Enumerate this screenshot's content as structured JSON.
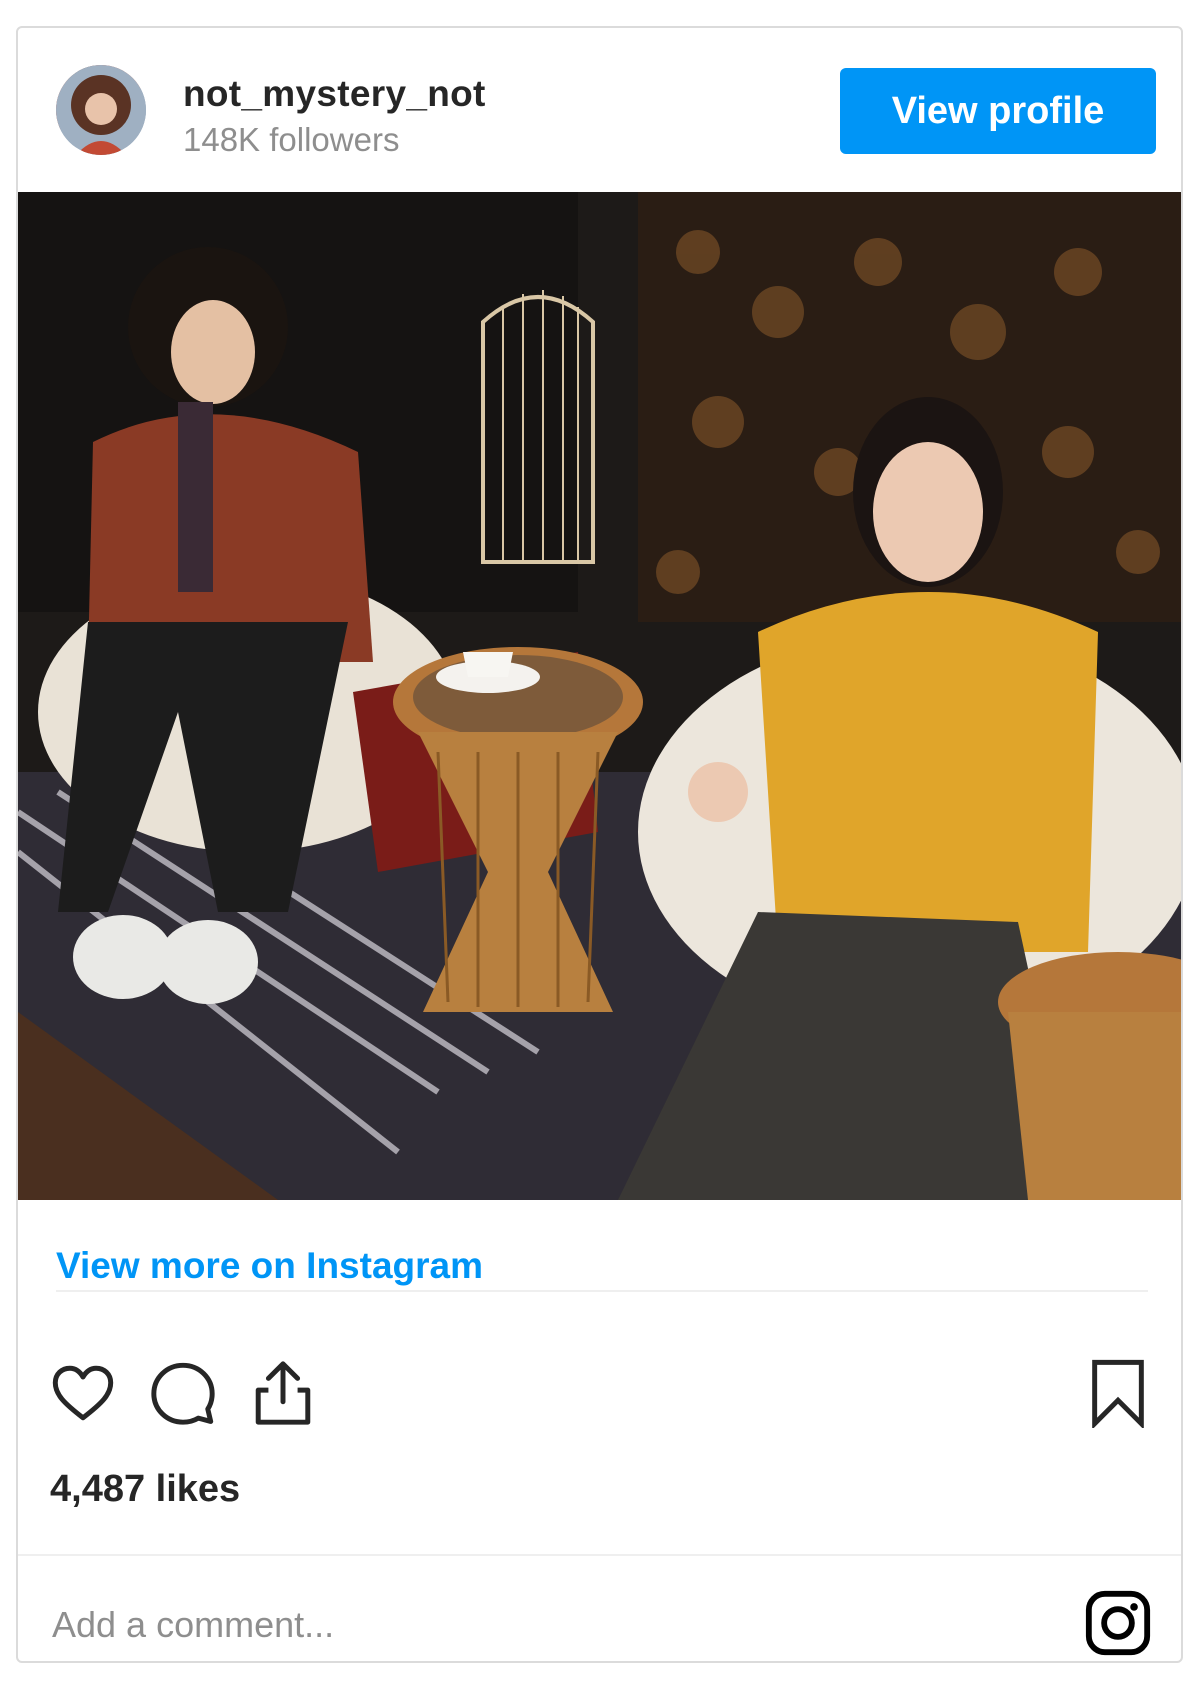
{
  "post": {
    "username": "not_mystery_not",
    "followers": "148K followers",
    "view_profile_label": "View profile",
    "view_more_label": "View more on Instagram",
    "likes": "4,487 likes",
    "comment_placeholder": "Add a comment..."
  },
  "icons": {
    "like": "heart-icon",
    "comment": "comment-icon",
    "share": "share-icon",
    "save": "bookmark-icon",
    "brand": "instagram-icon"
  },
  "colors": {
    "accent": "#0095f6",
    "text": "#262626",
    "muted": "#8e8e8e",
    "border": "#dbdbdb"
  }
}
